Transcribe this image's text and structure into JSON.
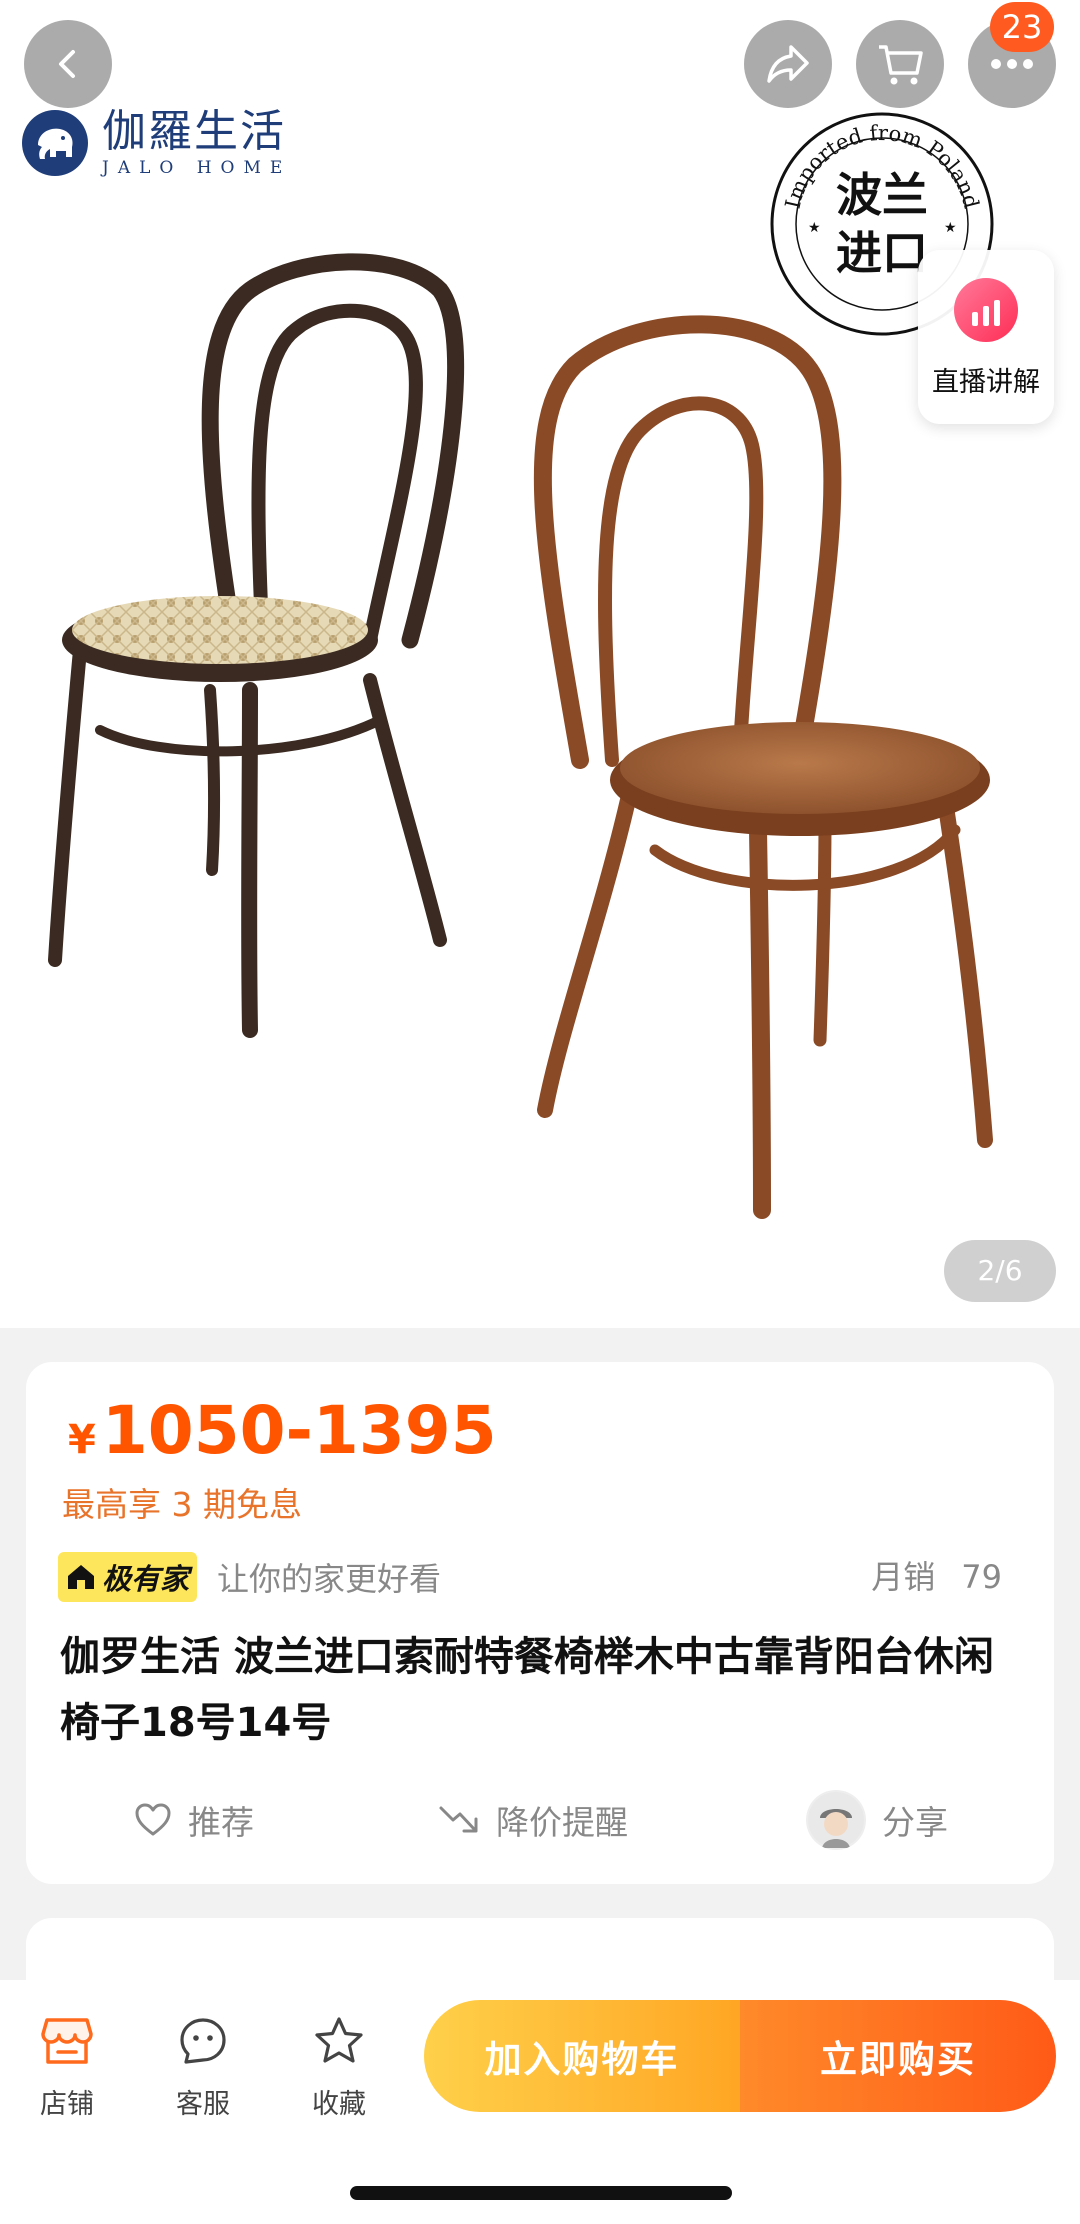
{
  "hero": {
    "brand_name": "伽羅生活",
    "brand_sub": "JALO HOME",
    "stamp_arc_text": "Imported from Poland",
    "stamp_text": "波兰进口",
    "live_label": "直播讲解",
    "pager": "2/6",
    "badge_count": "23"
  },
  "product": {
    "price_symbol": "¥",
    "price_range": "1050-1395",
    "promo": "最高享 3 期免息",
    "tag_chip": "极有家",
    "tag_slogan": "让你的家更好看",
    "sales_label": "月销",
    "sales_count": "79",
    "title": "伽罗生活 波兰进口索耐特餐椅榉木中古靠背阳台休闲椅子18号14号",
    "actions": {
      "recommend": "推荐",
      "price_alert": "降价提醒",
      "share": "分享"
    }
  },
  "bottom_bar": {
    "store": "店铺",
    "service": "客服",
    "favorite": "收藏",
    "add_to_cart": "加入购物车",
    "buy_now": "立即购买"
  },
  "colors": {
    "price": "#ff5500",
    "promo": "#e8742c",
    "cart_button": "#ffb62e",
    "buy_button": "#ff6a1c",
    "badge": "#ff5a1f",
    "brand": "#1f3d79"
  }
}
